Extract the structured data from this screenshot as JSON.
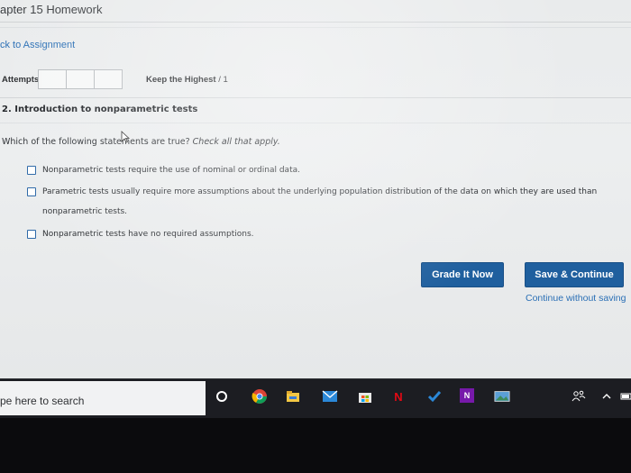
{
  "header": {
    "title": "apter 15 Homework",
    "back_link": "ck to Assignment"
  },
  "attempts": {
    "label": "Attempts",
    "keep_label": "Keep the Highest",
    "keep_value": "/ 1"
  },
  "question": {
    "title": "2. Introduction to nonparametric tests",
    "prompt": "Which of the following statements are true?",
    "instruction": "Check all that apply.",
    "options": [
      "Nonparametric tests require the use of nominal or ordinal data.",
      "Parametric tests usually require more assumptions about the underlying population distribution of the data on which they are used than nonparametric tests.",
      "Nonparametric tests have no required assumptions."
    ]
  },
  "actions": {
    "grade_label": "Grade It Now",
    "save_label": "Save & Continue",
    "continue_label": "Continue without saving"
  },
  "taskbar": {
    "search_placeholder": "pe here to search",
    "icons": [
      "cortana-icon",
      "chrome-icon",
      "file-explorer-icon",
      "mail-icon",
      "store-icon",
      "netflix-icon",
      "todo-icon",
      "onenote-icon",
      "image-icon",
      "people-icon",
      "chevron-up-icon",
      "battery-icon"
    ]
  },
  "colors": {
    "accent": "#1f5f9e",
    "link": "#2a6fb5"
  }
}
